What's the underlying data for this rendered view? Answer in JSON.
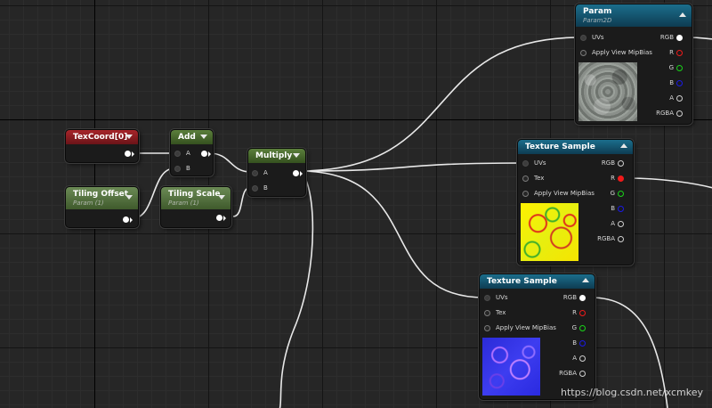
{
  "nodes": {
    "texcoord": {
      "title": "TexCoord[0]"
    },
    "add": {
      "title": "Add",
      "pins": [
        "A",
        "B"
      ]
    },
    "multiply": {
      "title": "Multiply",
      "pins": [
        "A",
        "B"
      ]
    },
    "tiling_offset": {
      "title": "Tiling Offset",
      "subtitle": "Param (1)"
    },
    "tiling_scale": {
      "title": "Tiling Scale",
      "subtitle": "Param (1)"
    },
    "param": {
      "title": "Param",
      "subtitle": "Param2D",
      "inputs": [
        "UVs",
        "Apply View MipBias"
      ],
      "outputs": [
        "RGB",
        "R",
        "G",
        "B",
        "A",
        "RGBA"
      ]
    },
    "tex_sample_1": {
      "title": "Texture Sample",
      "inputs": [
        "UVs",
        "Tex",
        "Apply View MipBias"
      ],
      "outputs": [
        "RGB",
        "R",
        "G",
        "B",
        "A",
        "RGBA"
      ]
    },
    "tex_sample_2": {
      "title": "Texture Sample",
      "inputs": [
        "UVs",
        "Tex",
        "Apply View MipBias"
      ],
      "outputs": [
        "RGB",
        "R",
        "G",
        "B",
        "A",
        "RGBA"
      ]
    }
  },
  "watermark": "https://blog.csdn.net/xcmkey",
  "colors": {
    "wire": "#ffffff",
    "red_pin": "#f01a1a",
    "green_pin": "#19d419",
    "blue_pin": "#1a1ae6"
  }
}
